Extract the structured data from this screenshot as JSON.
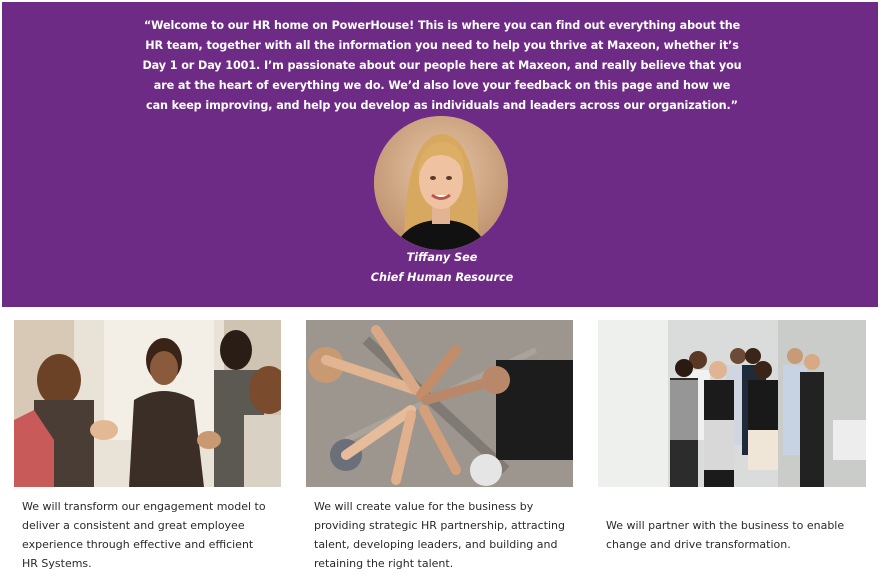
{
  "hero": {
    "quote": "“Welcome to our HR home on PowerHouse! This is where you can find out everything about the HR team, together with all the information you need to help you thrive at Maxeon, whether it’s Day 1 or Day 1001. I’m passionate about our people here at Maxeon, and really believe that you are at the heart of everything we do. We’d also love your feedback on this page and how we can keep improving, and help you develop as individuals and leaders across our organization.”",
    "name": "Tiffany See",
    "role": "Chief Human Resource",
    "background_color": "#6e2b86"
  },
  "cards": [
    {
      "text": "We will transform our engagement model to deliver a consistent and great employee experience through effective and efficient HR Systems."
    },
    {
      "text": "We will create value for the business by providing strategic HR partnership, attracting talent, developing leaders, and building and retaining the right talent."
    },
    {
      "text": "We will partner with the business to enable change and drive transformation."
    }
  ]
}
